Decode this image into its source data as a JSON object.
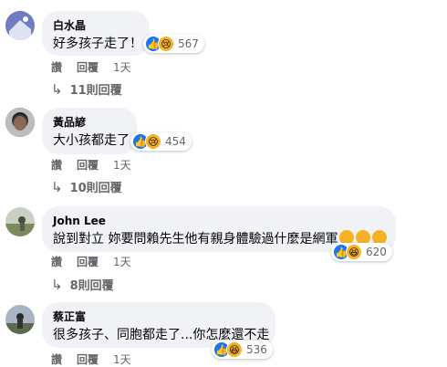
{
  "comments": [
    {
      "author": "白水晶",
      "text": "好多孩子走了！",
      "reactions": [
        "like",
        "sad"
      ],
      "reaction_count": "567",
      "actions": {
        "like": "讚",
        "reply": "回覆",
        "time": "1天"
      },
      "replies_label": "11則回覆"
    },
    {
      "author": "黃品諺",
      "text": "大小孩都走了",
      "reactions": [
        "like",
        "sad"
      ],
      "reaction_count": "454",
      "actions": {
        "like": "讚",
        "reply": "回覆",
        "time": "1天"
      },
      "replies_label": "10則回覆"
    },
    {
      "author": "John Lee",
      "text": "說到對立 妳要問賴先生他有親身體驗過什麼是網軍",
      "reactions": [
        "like",
        "haha"
      ],
      "reaction_count": "620",
      "actions": {
        "like": "讚",
        "reply": "回覆",
        "time": "1天"
      },
      "replies_label": "8則回覆"
    },
    {
      "author": "蔡正富",
      "text": "很多孩子、同胞都走了...你怎麼還不走",
      "reactions": [
        "like",
        "haha"
      ],
      "reaction_count": "536",
      "actions": {
        "like": "讚",
        "reply": "回覆",
        "time": "1天"
      }
    }
  ],
  "colors": {
    "bubble": "#f0f2f5",
    "secondary_text": "#65676b",
    "like_blue": "#1877f2",
    "emoji_yellow": "#f7b125"
  }
}
